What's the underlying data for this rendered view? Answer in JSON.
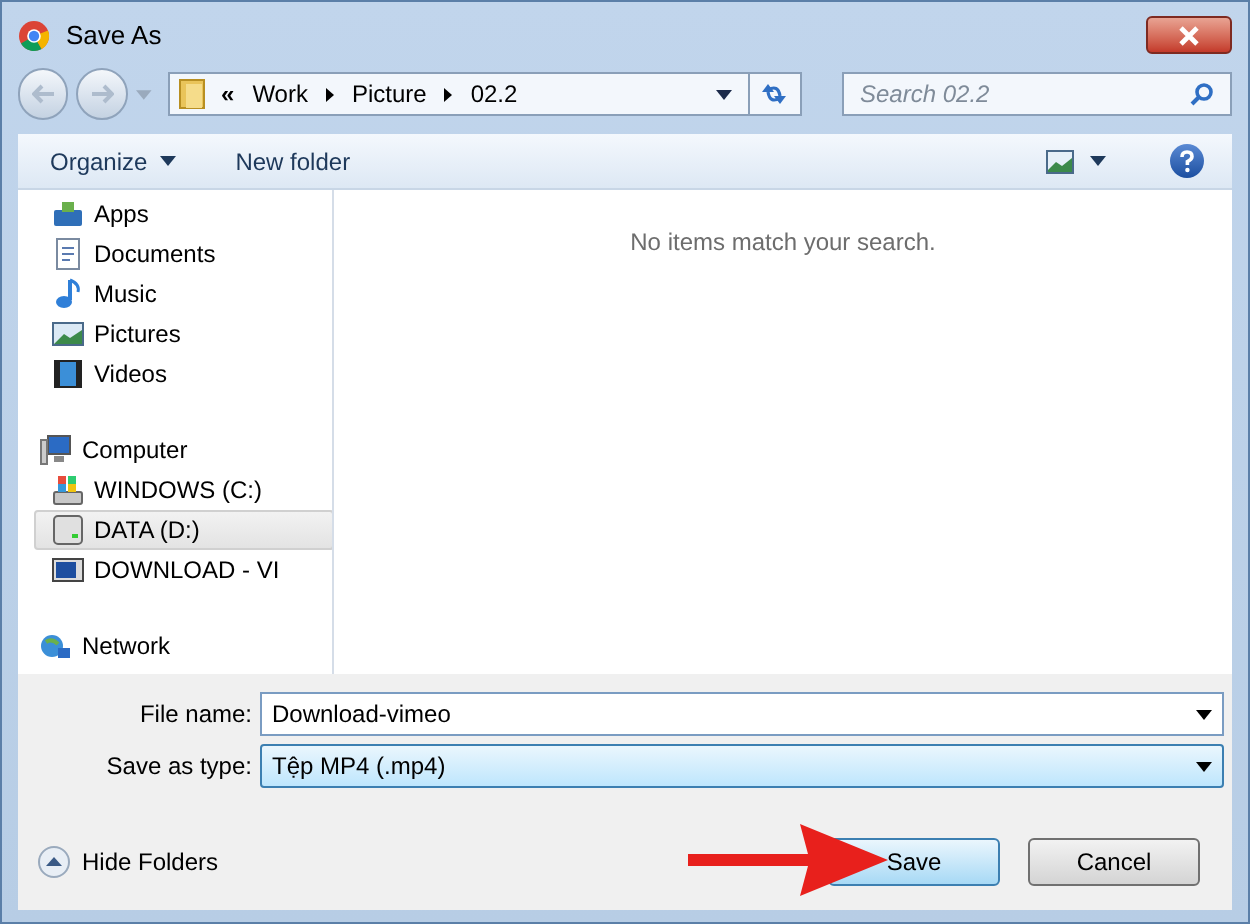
{
  "window": {
    "title": "Save As"
  },
  "address": {
    "overflow": "«",
    "crumbs": [
      "Work",
      "Picture",
      "02.2"
    ]
  },
  "search": {
    "placeholder": "Search 02.2"
  },
  "toolbar": {
    "organize": "Organize",
    "new_folder": "New folder"
  },
  "sidebar": {
    "items": [
      {
        "label": "Apps",
        "kind": "apps",
        "selected": false
      },
      {
        "label": "Documents",
        "kind": "documents",
        "selected": false
      },
      {
        "label": "Music",
        "kind": "music",
        "selected": false
      },
      {
        "label": "Pictures",
        "kind": "pictures",
        "selected": false
      },
      {
        "label": "Videos",
        "kind": "videos",
        "selected": false
      },
      {
        "label": "Computer",
        "kind": "computer",
        "selected": false
      },
      {
        "label": "WINDOWS (C:)",
        "kind": "system-drive",
        "selected": false
      },
      {
        "label": "DATA (D:)",
        "kind": "drive",
        "selected": true
      },
      {
        "label": "DOWNLOAD - VI",
        "kind": "media-drive",
        "selected": false
      },
      {
        "label": "Network",
        "kind": "network",
        "selected": false
      }
    ]
  },
  "content": {
    "message": "No items match your search."
  },
  "form": {
    "file_name_label": "File name:",
    "file_name": "Download-vimeo",
    "type_label": "Save as type:",
    "type": "Tệp MP4 (.mp4)"
  },
  "footer": {
    "hide_folders": "Hide Folders",
    "save": "Save",
    "cancel": "Cancel"
  }
}
